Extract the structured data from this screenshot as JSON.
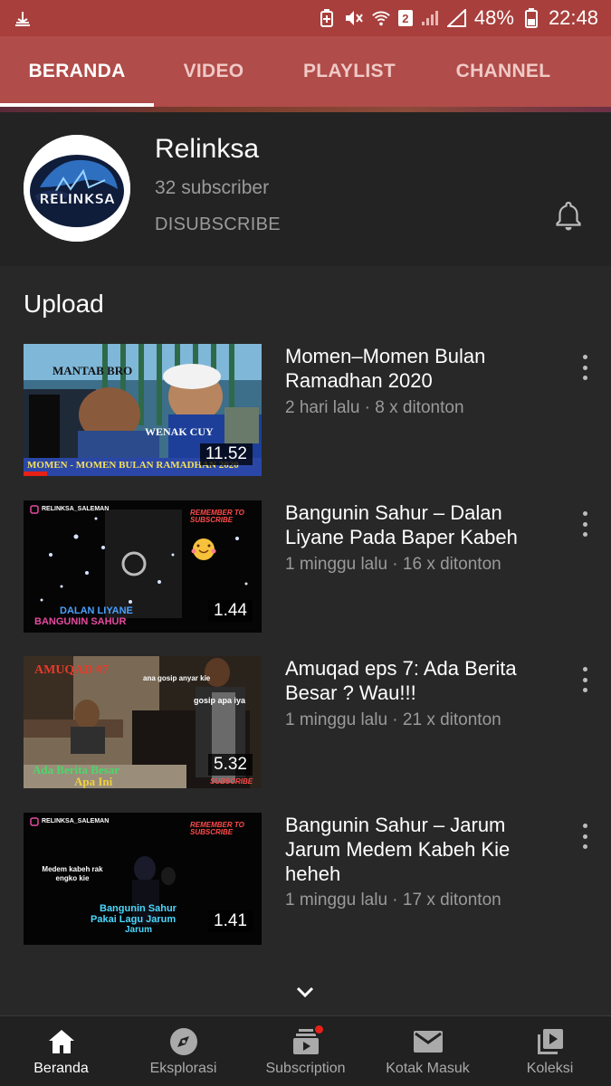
{
  "status": {
    "battery": "48%",
    "time": "22:48",
    "sim_badge": "2"
  },
  "tabs": [
    {
      "label": "BERANDA",
      "active": true
    },
    {
      "label": "VIDEO",
      "active": false
    },
    {
      "label": "PLAYLIST",
      "active": false
    },
    {
      "label": "CHANNEL",
      "active": false
    }
  ],
  "channel": {
    "name": "Relinksa",
    "subscribers": "32 subscriber",
    "unsubscribe_label": "DISUBSCRIBE",
    "logo_text": "RELINKSA"
  },
  "section": {
    "title": "Upload"
  },
  "videos": [
    {
      "title": "Momen–Momen Bulan Ramadhan 2020",
      "meta": "2 hari lalu · 8 x ditonton",
      "duration": "11.52",
      "thumb_texts": [
        "MANTAB BRO",
        "WENAK CUY",
        "MOMEN - MOMEN BULAN RAMADHAN 2020"
      ],
      "watched_fraction": 0.1
    },
    {
      "title": "Bangunin Sahur – Dalan Liyane Pada Baper Kabeh",
      "meta": "1 minggu lalu · 16 x ditonton",
      "duration": "1.44",
      "thumb_texts": [
        "RELINKSA_SALEMAN",
        "REMEMBER TO SUBSCRIBE",
        "DALAN LIYANE",
        "BANGUNIN SAHUR"
      ]
    },
    {
      "title": "Amuqad eps 7: Ada Berita Besar ? Wau!!!",
      "meta": "1 minggu lalu · 21 x ditonton",
      "duration": "5.32",
      "thumb_texts": [
        "AMUQAD #7",
        "ana gosip anyar kie",
        "gosip apa iya",
        "Ada Berita Besar",
        "Apa Ini",
        "SUBSCRIBE"
      ]
    },
    {
      "title": "Bangunin Sahur – Jarum Jarum Medem Kabeh Kie heheh",
      "meta": "1 minggu lalu · 17 x ditonton",
      "duration": "1.41",
      "thumb_texts": [
        "RELINKSA_SALEMAN",
        "REMEMBER TO SUBSCRIBE",
        "Medem kabeh rak engko kie",
        "Bangunin Sahur",
        "Pakai Lagu Jarum",
        "Jarum"
      ]
    }
  ],
  "bottom_nav": [
    {
      "label": "Beranda",
      "icon": "home-icon",
      "active": true
    },
    {
      "label": "Eksplorasi",
      "icon": "compass-icon",
      "active": false
    },
    {
      "label": "Subscription",
      "icon": "subscriptions-icon",
      "active": false
    },
    {
      "label": "Kotak Masuk",
      "icon": "inbox-icon",
      "active": false
    },
    {
      "label": "Koleksi",
      "icon": "library-icon",
      "active": false
    }
  ],
  "colors": {
    "status_bar": "#a83f3c",
    "tab_bar": "#b04c49",
    "background": "#282828",
    "accent_red": "#e62117"
  }
}
